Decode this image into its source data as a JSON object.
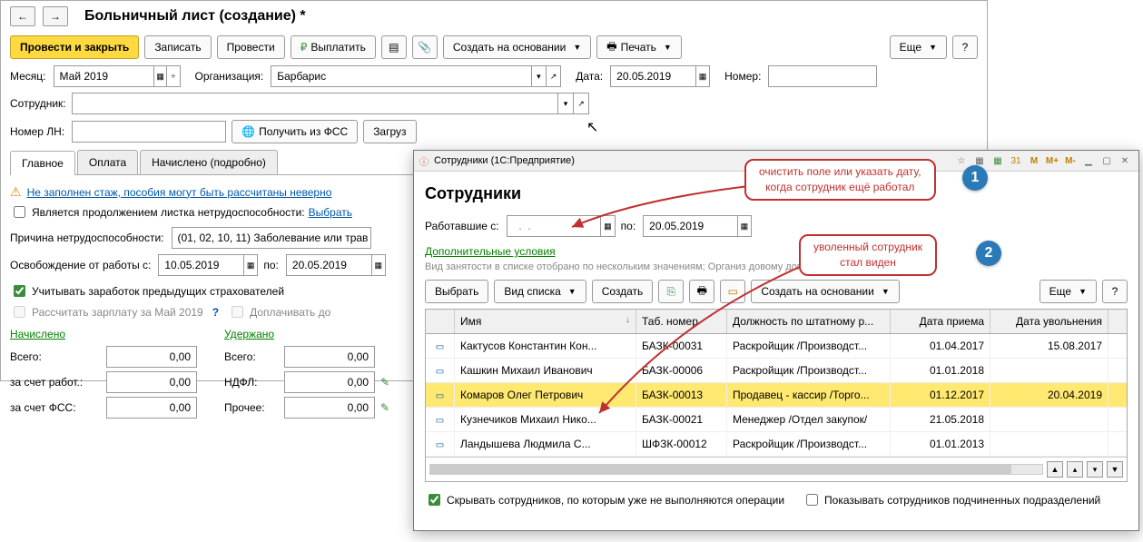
{
  "main": {
    "title": "Больничный лист (создание) *",
    "toolbar": {
      "submit": "Провести и закрыть",
      "write": "Записать",
      "post": "Провести",
      "pay": "Выплатить",
      "create_based": "Создать на основании",
      "print": "Печать",
      "more": "Еще",
      "help": "?"
    },
    "fields": {
      "month_label": "Месяц:",
      "month_value": "Май 2019",
      "org_label": "Организация:",
      "org_value": "Барбарис",
      "date_label": "Дата:",
      "date_value": "20.05.2019",
      "number_label": "Номер:",
      "employee_label": "Сотрудник:",
      "employee_value": "",
      "ln_label": "Номер ЛН:",
      "getfss": "Получить из ФСС",
      "loadfile": "Загруз"
    },
    "tabs": {
      "main": "Главное",
      "pay": "Оплата",
      "calc": "Начислено (подробно)"
    },
    "content": {
      "warning": "Не заполнен стаж, пособия могут быть рассчитаны неверно",
      "continuation": "Является продолжением листка нетрудоспособности:",
      "choose": "Выбрать",
      "reason_label": "Причина нетрудоспособности:",
      "reason_value": "(01, 02, 10, 11) Заболевание или трав",
      "release_label": "Освобождение от работы с:",
      "release_from": "10.05.2019",
      "release_to_label": "по:",
      "release_to": "20.05.2019",
      "consider": "Учитывать заработок предыдущих страхователей",
      "recalc": "Рассчитать зарплату за Май 2019",
      "extra_pay": "Доплачивать до"
    },
    "totals": {
      "accrued": "Начислено",
      "withheld": "Удержано",
      "total": "Всего:",
      "employer": "за счет работ.:",
      "fss": "за счет ФСС:",
      "ndfl": "НДФЛ:",
      "other": "Прочее:",
      "zero": "0,00"
    }
  },
  "popup": {
    "title": "Сотрудники  (1С:Предприятие)",
    "heading": "Сотрудники",
    "worked_from": "Работавшие с:",
    "worked_to": "по:",
    "date_from": "",
    "date_to": "20.05.2019",
    "conditions": "Дополнительные условия",
    "filter_desc": "Вид занятости в списке отобрано по нескольким значениям; Организ                                                                                                довому договору: Да; Ф...",
    "toolbar": {
      "choose": "Выбрать",
      "view": "Вид списка",
      "create": "Создать",
      "create_based": "Создать на основании",
      "more": "Еще",
      "help": "?"
    },
    "columns": {
      "name": "Имя",
      "tab": "Таб. номер",
      "position": "Должность по штатному р...",
      "hired": "Дата приема",
      "fired": "Дата увольнения"
    },
    "rows": [
      {
        "name": "Кактусов Константин Кон...",
        "tab": "БАЗК-00031",
        "pos": "Раскройщик /Производст...",
        "hired": "01.04.2017",
        "fired": "15.08.2017"
      },
      {
        "name": "Кашкин Михаил Иванович",
        "tab": "БАЗК-00006",
        "pos": "Раскройщик /Производст...",
        "hired": "01.01.2018",
        "fired": ""
      },
      {
        "name": "Комаров Олег Петрович",
        "tab": "БАЗК-00013",
        "pos": "Продавец - кассир /Торго...",
        "hired": "01.12.2017",
        "fired": "20.04.2019"
      },
      {
        "name": "Кузнечиков Михаил Нико...",
        "tab": "БАЗК-00021",
        "pos": "Менеджер /Отдел закупок/",
        "hired": "21.05.2018",
        "fired": ""
      },
      {
        "name": "Ландышева Людмила С...",
        "tab": "ШФЗК-00012",
        "pos": "Раскройщик /Производст...",
        "hired": "01.01.2013",
        "fired": ""
      }
    ],
    "bottom": {
      "hide": "Скрывать сотрудников, по которым уже не выполняются операции",
      "show_sub": "Показывать сотрудников подчиненных подразделений"
    }
  },
  "callouts": {
    "c1": "очистить поле или указать дату,\nкогда сотрудник ещё работал",
    "c2": "уволенный сотрудник\nстал виден"
  }
}
